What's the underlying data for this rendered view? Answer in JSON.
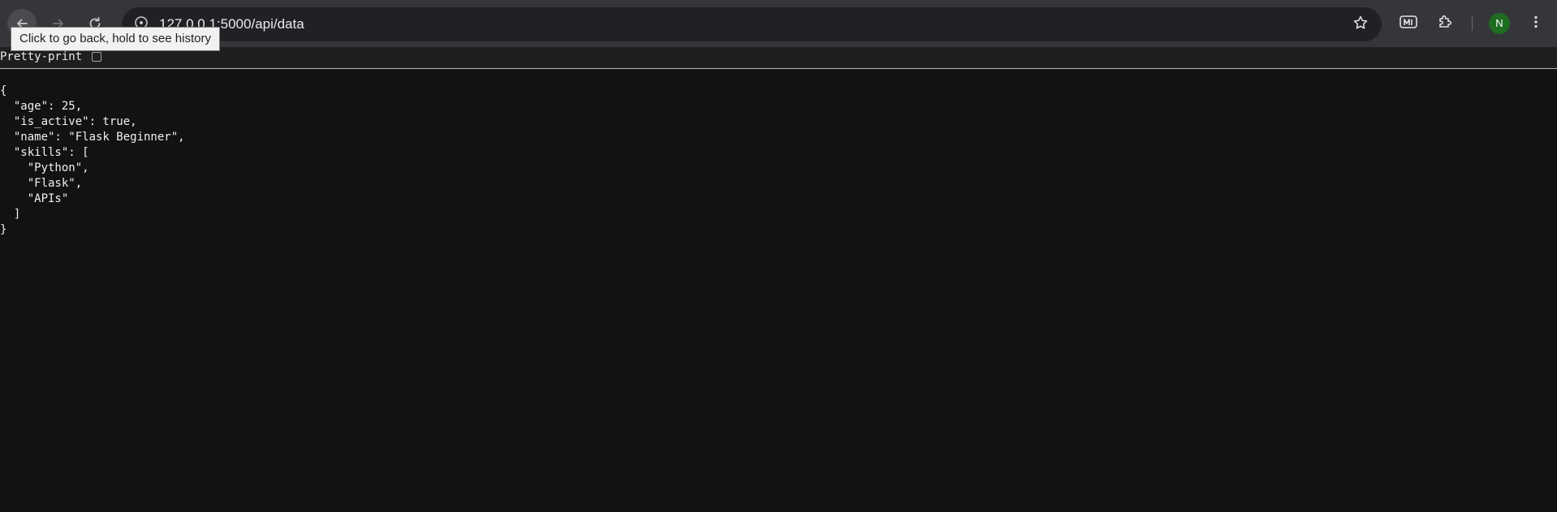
{
  "browser": {
    "url": "127.0.0.1:5000/api/data",
    "profile_initial": "N",
    "tooltip": "Click to go back, hold to see history",
    "icons": {
      "back": "arrow-left-icon",
      "forward": "arrow-right-icon",
      "reload": "reload-icon",
      "site_info": "site-info-icon",
      "bookmark": "star-icon",
      "extension": "extension-m-icon",
      "extensions_menu": "puzzle-icon",
      "menu": "kebab-menu-icon"
    },
    "colors": {
      "toolbar": "#35363a",
      "omnibox": "#202124",
      "avatar": "#1e6b22"
    }
  },
  "viewer": {
    "pretty_print_label": "Pretty-print",
    "pretty_print_checked": false,
    "json_lines": [
      "{",
      "  \"age\": 25,",
      "  \"is_active\": true,",
      "  \"name\": \"Flask Beginner\",",
      "  \"skills\": [",
      "    \"Python\",",
      "    \"Flask\",",
      "    \"APIs\"",
      "  ]",
      "}"
    ]
  }
}
